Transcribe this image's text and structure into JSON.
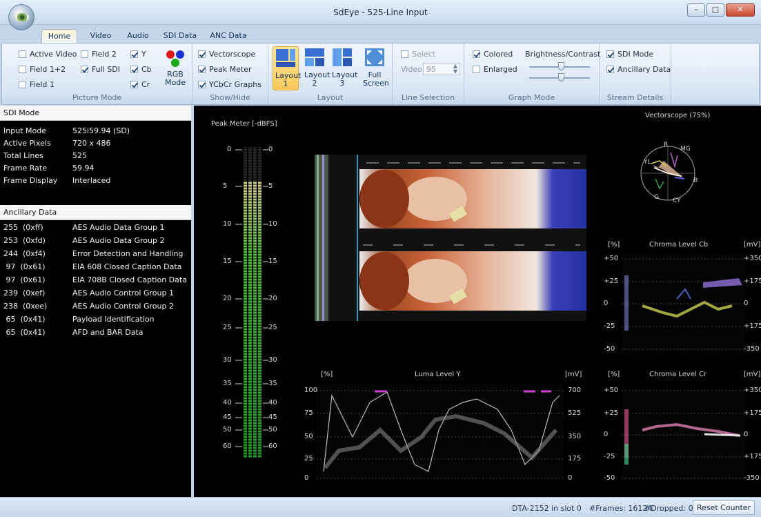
{
  "window": {
    "title": "SdEye - 525-Line Input",
    "min": "–",
    "max": "□",
    "close": "✕"
  },
  "tabs": [
    "Home",
    "Video",
    "Audio",
    "SDI Data",
    "ANC Data"
  ],
  "ribbon": {
    "picture_mode": {
      "label": "Picture Mode",
      "items": [
        {
          "label": "Active Video",
          "checked": false
        },
        {
          "label": "Field 1+2",
          "checked": false
        },
        {
          "label": "Field 1",
          "checked": false
        },
        {
          "label": "Field 2",
          "checked": false
        },
        {
          "label": "Full SDI",
          "checked": true
        },
        {
          "label": "Y",
          "checked": true
        },
        {
          "label": "Cb",
          "checked": true
        },
        {
          "label": "Cr",
          "checked": true
        }
      ],
      "rgb_mode": "RGB Mode"
    },
    "show_hide": {
      "label": "Show/Hide",
      "items": [
        {
          "label": "Vectorscope",
          "checked": true
        },
        {
          "label": "Peak Meter",
          "checked": true
        },
        {
          "label": "YCbCr Graphs",
          "checked": true
        }
      ]
    },
    "layout": {
      "label": "Layout",
      "buttons": [
        {
          "label": "Layout 1",
          "active": true
        },
        {
          "label": "Layout 2",
          "active": false
        },
        {
          "label": "Layout 3",
          "active": false
        }
      ],
      "full_screen": "Full Screen"
    },
    "line_selection": {
      "label": "Line Selection",
      "select_label": "Select",
      "video_label": "Video",
      "video_value": "95"
    },
    "graph_mode": {
      "label": "Graph Mode",
      "colored": "Colored",
      "enlarged": "Enlarged",
      "brightness_contrast": "Brightness/Contrast"
    },
    "stream_details": {
      "label": "Stream Details",
      "items": [
        {
          "label": "SDI Mode",
          "checked": true
        },
        {
          "label": "Ancillary Data",
          "checked": true
        }
      ]
    }
  },
  "sdi_mode": {
    "title": "SDI Mode",
    "rows": [
      {
        "key": "Input Mode",
        "value": "525i59.94  (SD)"
      },
      {
        "key": "Active Pixels",
        "value": "720 x 486"
      },
      {
        "key": "Total Lines",
        "value": "525"
      },
      {
        "key": "Frame Rate",
        "value": "59.94"
      },
      {
        "key": "Frame Display",
        "value": "Interlaced"
      }
    ]
  },
  "ancillary_data": {
    "title": "Ancillary Data",
    "rows": [
      {
        "id": "255  (0xff)",
        "desc": "AES Audio Data Group 1"
      },
      {
        "id": "253  (0xfd)",
        "desc": "AES Audio Data Group 2"
      },
      {
        "id": "244  (0xf4)",
        "desc": "Error Detection and Handling"
      },
      {
        "id": " 97  (0x61)",
        "desc": "EIA 608 Closed Caption Data"
      },
      {
        "id": " 97  (0x61)",
        "desc": "EIA 708B Closed Caption Data"
      },
      {
        "id": "239  (0xef)",
        "desc": "AES Audio Control Group 1"
      },
      {
        "id": "238  (0xee)",
        "desc": "AES Audio Control Group 2"
      },
      {
        "id": " 65  (0x41)",
        "desc": "Payload Identification"
      },
      {
        "id": " 65  (0x41)",
        "desc": "AFD and BAR Data"
      }
    ]
  },
  "peak_meter": {
    "title": "Peak Meter [-dBFS]",
    "scale": [
      "0",
      "5",
      "10",
      "15",
      "20",
      "25",
      "30",
      "35",
      "40",
      "45",
      "50",
      "60"
    ]
  },
  "vectorscope": {
    "title": "Vectorscope (75%)",
    "targets": [
      "R",
      "MG",
      "YL",
      "B",
      "G",
      "CY"
    ]
  },
  "luma": {
    "title": "Luma Level Y",
    "unit_left": "[%]",
    "unit_right": "[mV]",
    "left": [
      "100",
      "75",
      "50",
      "25",
      "0"
    ],
    "right": [
      "700",
      "525",
      "350",
      "175",
      "0"
    ]
  },
  "chroma_cb": {
    "title": "Chroma Level Cb",
    "unit_left": "[%]",
    "unit_right": "[mV]",
    "left": [
      "+50",
      "+25",
      "0",
      "-25",
      "-50"
    ],
    "right": [
      "+350",
      "+175",
      "0",
      "+175",
      "-350"
    ]
  },
  "chroma_cr": {
    "title": "Chroma Level Cr",
    "unit_left": "[%]",
    "unit_right": "[mV]",
    "left": [
      "+50",
      "+25",
      "0",
      "-25",
      "-50"
    ],
    "right": [
      "+350",
      "+175",
      "0",
      "+175",
      "-350"
    ]
  },
  "status": {
    "slot": "DTA-2152 in slot 0",
    "frames": "#Frames: 16124",
    "dropped": "#Dropped: 0",
    "reset": "Reset Counter"
  }
}
